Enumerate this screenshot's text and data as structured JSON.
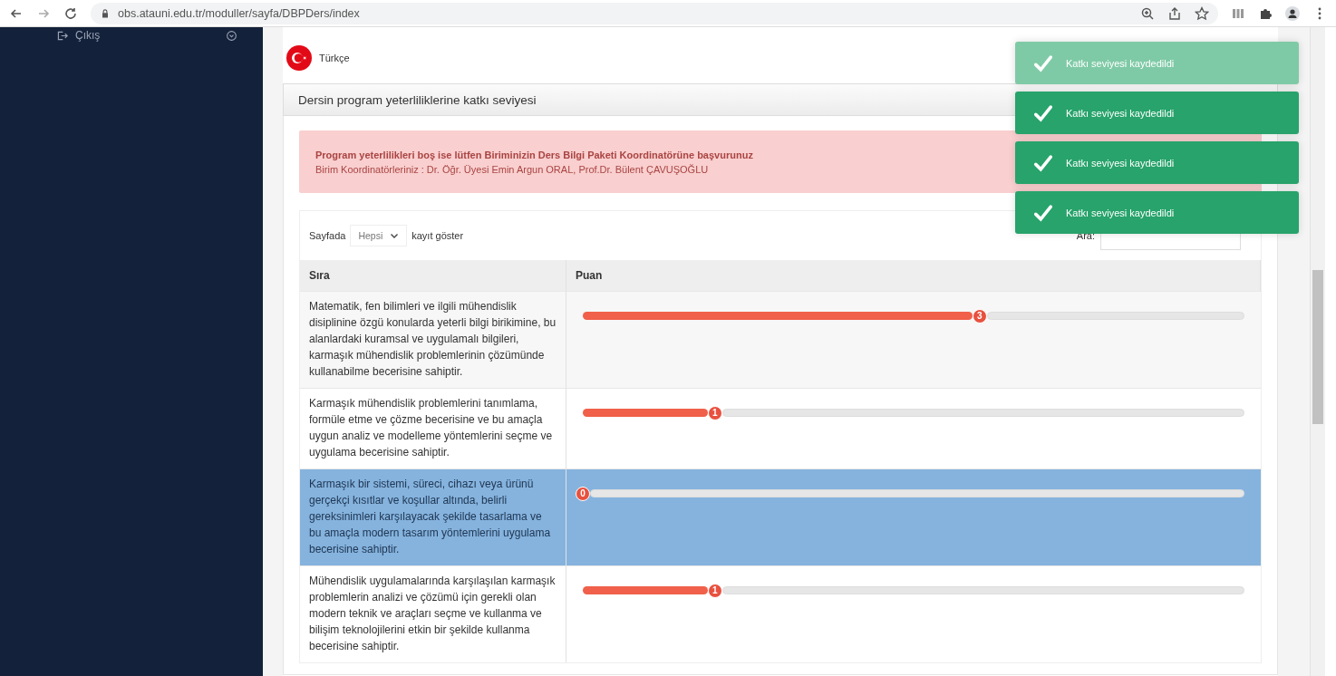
{
  "browser": {
    "url": "obs.atauni.edu.tr/moduller/sayfa/DBPDers/index"
  },
  "sidebar": {
    "items": [
      {
        "label": "Çıkış"
      }
    ]
  },
  "language": {
    "label": "Türkçe"
  },
  "panel": {
    "title": "Dersin program yeterliliklerine katkı seviyesi"
  },
  "alert": {
    "heading": "Program yeterlilikleri boş ise lütfen Biriminizin Ders Bilgi Paketi Koordinatörüne başvurunuz",
    "text": "Birim Koordinatörleriniz : Dr. Öğr. Üyesi Emin Argun ORAL, Prof.Dr. Bülent ÇAVUŞOĞLU"
  },
  "table_controls": {
    "length_prefix": "Sayfada",
    "length_value": "Hepsi",
    "length_suffix": "kayıt göster",
    "search_label": "Ara:"
  },
  "table": {
    "columns": [
      "Sıra",
      "Puan"
    ],
    "rows": [
      {
        "text": "Matematik, fen bilimleri ve ilgili mühendislik disiplinine özgü konularda yeterli bilgi birikimine, bu alanlardaki kuramsal ve uygulamalı bilgileri, karmaşık mühendislik problemlerinin çözümünde kullanabilme becerisine sahiptir.",
        "value": "3",
        "level": 0.6,
        "selected": false
      },
      {
        "text": "Karmaşık mühendislik problemlerini tanımlama, formüle etme ve çözme becerisine ve bu amaçla uygun analiz ve modelleme yöntemlerini seçme ve uygulama becerisine sahiptir.",
        "value": "1",
        "level": 0.2,
        "selected": false
      },
      {
        "text": "Karmaşık bir sistemi, süreci, cihazı veya ürünü gerçekçi kısıtlar ve koşullar altında, belirli gereksinimleri karşılayacak şekilde tasarlama ve bu amaçla modern tasarım yöntemlerini uygulama becerisine sahiptir.",
        "value": "0",
        "level": 0,
        "selected": true
      },
      {
        "text": "Mühendislik uygulamalarında karşılaşılan karmaşık problemlerin analizi ve çözümü için gerekli olan modern teknik ve araçları seçme ve kullanma ve bilişim teknolojilerini etkin bir şekilde kullanma becerisine sahiptir.",
        "value": "1",
        "level": 0.2,
        "selected": false
      }
    ]
  },
  "toasts": [
    {
      "text": "Katkı seviyesi kaydedildi",
      "fading": true
    },
    {
      "text": "Katkı seviyesi kaydedildi",
      "fading": false
    },
    {
      "text": "Katkı seviyesi kaydedildi",
      "fading": false
    },
    {
      "text": "Katkı seviyesi kaydedildi",
      "fading": false
    }
  ]
}
